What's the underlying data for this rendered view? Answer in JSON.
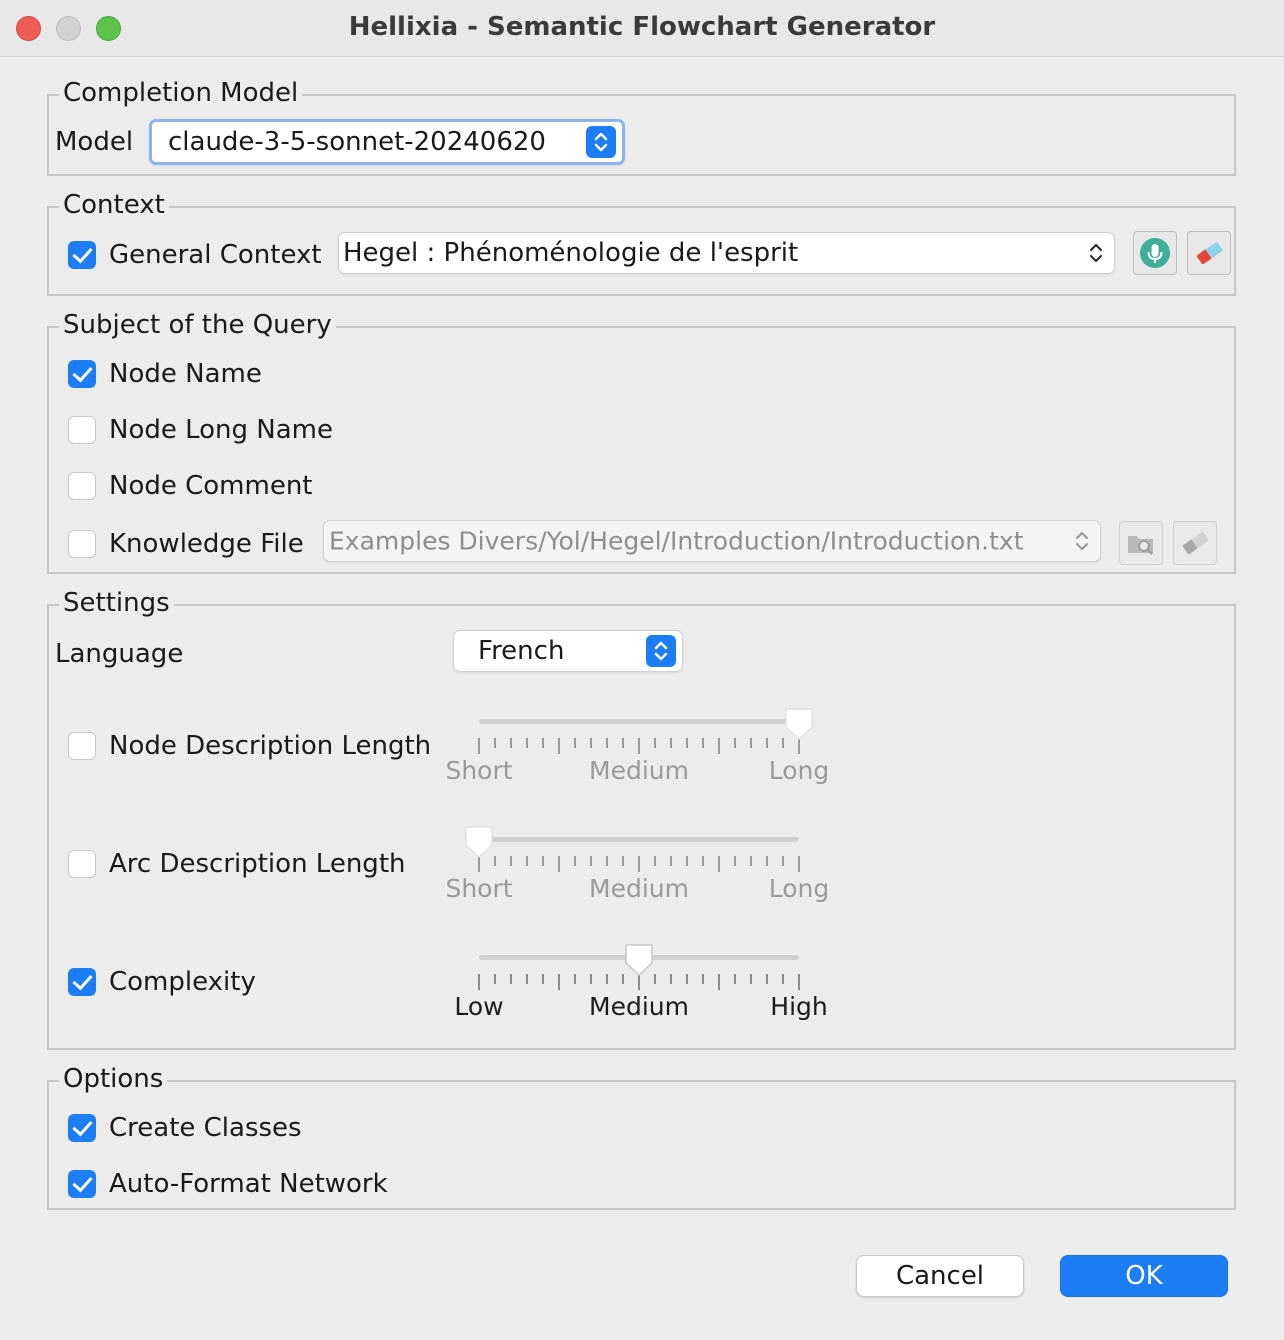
{
  "window": {
    "title": "Hellixia - Semantic Flowchart Generator"
  },
  "completion_model": {
    "legend": "Completion Model",
    "model_label": "Model",
    "model_value": "claude-3-5-sonnet-20240620"
  },
  "context": {
    "legend": "Context",
    "general_context_label": "General Context",
    "general_context_checked": true,
    "context_value": "Hegel : Phénoménologie de l'esprit",
    "mic_icon": "microphone-icon",
    "clear_icon": "eraser-icon"
  },
  "subject": {
    "legend": "Subject of the Query",
    "items": [
      {
        "label": "Node Name",
        "checked": true
      },
      {
        "label": "Node Long Name",
        "checked": false
      },
      {
        "label": "Node Comment",
        "checked": false
      },
      {
        "label": "Knowledge File",
        "checked": false
      }
    ],
    "knowledge_file_value": "Examples Divers/Yol/Hegel/Introduction/Introduction.txt",
    "browse_icon": "folder-search-icon",
    "clear_icon": "eraser-icon"
  },
  "settings": {
    "legend": "Settings",
    "language_label": "Language",
    "language_value": "French",
    "node_desc": {
      "label": "Node Description Length",
      "checked": false,
      "labels": [
        "Short",
        "Medium",
        "Long"
      ],
      "level": 1.0
    },
    "arc_desc": {
      "label": "Arc Description Length",
      "checked": false,
      "labels": [
        "Short",
        "Medium",
        "Long"
      ],
      "level": 0.0
    },
    "complexity": {
      "label": "Complexity",
      "checked": true,
      "labels": [
        "Low",
        "Medium",
        "High"
      ],
      "level": 0.5
    }
  },
  "options": {
    "legend": "Options",
    "items": [
      {
        "label": "Create Classes",
        "checked": true
      },
      {
        "label": "Auto-Format Network",
        "checked": true
      }
    ]
  },
  "buttons": {
    "cancel": "Cancel",
    "ok": "OK"
  },
  "colors": {
    "accent": "#1c7df5",
    "window_bg": "#ececec"
  }
}
